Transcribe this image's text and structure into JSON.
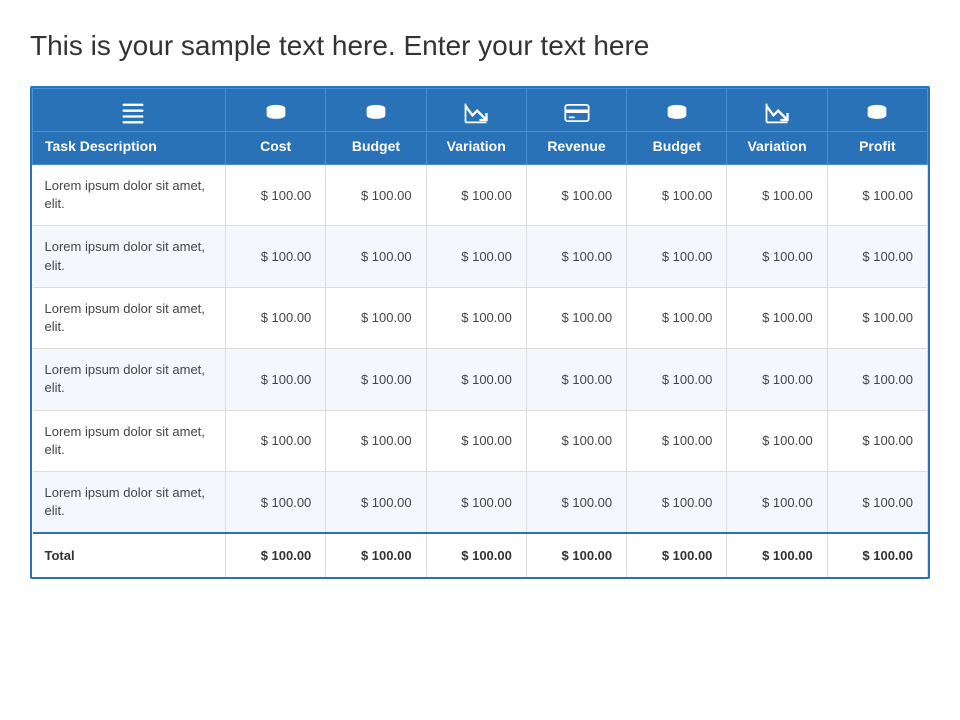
{
  "title": "This is your sample text here. Enter your text here",
  "headers": {
    "icons": [
      "list",
      "coins",
      "coins",
      "chart-down",
      "card",
      "coins",
      "chart-down",
      "coins"
    ],
    "labels": [
      "Task Description",
      "Cost",
      "Budget",
      "Variation",
      "Revenue",
      "Budget",
      "Variation",
      "Profit"
    ]
  },
  "rows": [
    {
      "task": "Lorem ipsum dolor sit amet, elit.",
      "values": [
        "$ 100.00",
        "$ 100.00",
        "$ 100.00",
        "$ 100.00",
        "$ 100.00",
        "$ 100.00",
        "$ 100.00"
      ]
    },
    {
      "task": "Lorem ipsum dolor sit amet, elit.",
      "values": [
        "$ 100.00",
        "$ 100.00",
        "$ 100.00",
        "$ 100.00",
        "$ 100.00",
        "$ 100.00",
        "$ 100.00"
      ]
    },
    {
      "task": "Lorem ipsum dolor sit amet, elit.",
      "values": [
        "$ 100.00",
        "$ 100.00",
        "$ 100.00",
        "$ 100.00",
        "$ 100.00",
        "$ 100.00",
        "$ 100.00"
      ]
    },
    {
      "task": "Lorem ipsum dolor sit amet, elit.",
      "values": [
        "$ 100.00",
        "$ 100.00",
        "$ 100.00",
        "$ 100.00",
        "$ 100.00",
        "$ 100.00",
        "$ 100.00"
      ]
    },
    {
      "task": "Lorem ipsum dolor sit amet, elit.",
      "values": [
        "$ 100.00",
        "$ 100.00",
        "$ 100.00",
        "$ 100.00",
        "$ 100.00",
        "$ 100.00",
        "$ 100.00"
      ]
    },
    {
      "task": "Lorem ipsum dolor sit amet, elit.",
      "values": [
        "$ 100.00",
        "$ 100.00",
        "$ 100.00",
        "$ 100.00",
        "$ 100.00",
        "$ 100.00",
        "$ 100.00"
      ]
    }
  ],
  "total": {
    "label": "Total",
    "values": [
      "$ 100.00",
      "$ 100.00",
      "$ 100.00",
      "$ 100.00",
      "$ 100.00",
      "$ 100.00",
      "$ 100.00"
    ]
  },
  "colors": {
    "header_bg": "#2a72b8",
    "border": "#4a90d9",
    "row_even": "#f4f8fd"
  }
}
